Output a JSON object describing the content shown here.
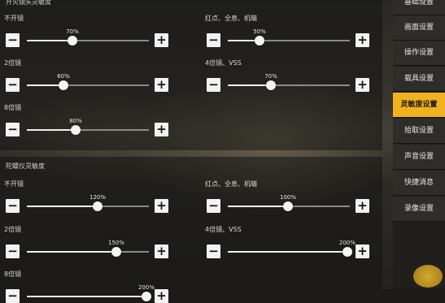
{
  "section1": {
    "title": "开火镜头灵敏度",
    "settings": [
      {
        "label": "不开镜",
        "value": "70%",
        "level": 0.37
      },
      {
        "label": "红点、全息、机瞄",
        "value": "50%",
        "level": 0.26
      },
      {
        "label": "2倍镜",
        "value": "60%",
        "level": 0.3
      },
      {
        "label": "4倍镜、VSS",
        "value": "70%",
        "level": 0.35
      },
      {
        "label": "8倍镜",
        "value": "80%",
        "level": 0.4
      }
    ]
  },
  "section2": {
    "title": "陀螺仪灵敏度",
    "settings": [
      {
        "label": "不开镜",
        "value": "120%",
        "level": 0.58
      },
      {
        "label": "红点、全息、机瞄",
        "value": "100%",
        "level": 0.49
      },
      {
        "label": "2倍镜",
        "value": "150%",
        "level": 0.73
      },
      {
        "label": "4倍镜、VSS",
        "value": "200%",
        "level": 0.98
      },
      {
        "label": "8倍镜",
        "value": "200%",
        "level": 0.98
      }
    ]
  },
  "menu": {
    "items": [
      {
        "label": "基础设置",
        "active": false
      },
      {
        "label": "画面设置",
        "active": false
      },
      {
        "label": "操作设置",
        "active": false
      },
      {
        "label": "载具设置",
        "active": false
      },
      {
        "label": "灵敏度设置",
        "active": true
      },
      {
        "label": "拾取设置",
        "active": false
      },
      {
        "label": "声音设置",
        "active": false
      },
      {
        "label": "快捷消息",
        "active": false
      },
      {
        "label": "录像设置",
        "active": false
      }
    ]
  },
  "icons": {
    "minus": "minus-icon",
    "plus": "plus-icon"
  },
  "colors": {
    "accent": "#f0b21e",
    "menu_bg": "#2e2d29"
  }
}
